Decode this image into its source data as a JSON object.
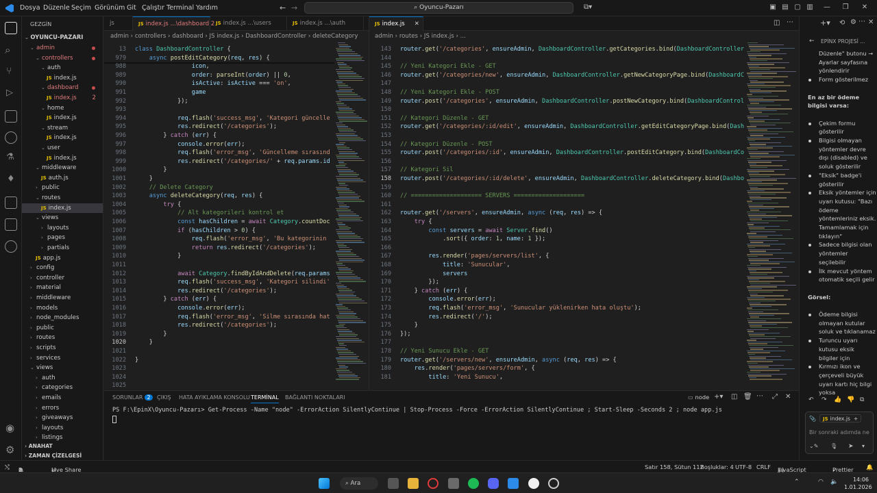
{
  "titlebar": {
    "menu": [
      "Dosya",
      "Düzenle",
      "Seçim",
      "Görünüm",
      "Git",
      "Çalıştır",
      "Terminal",
      "Yardım"
    ],
    "search": "Oyuncu-Pazarı"
  },
  "sidebar": {
    "header": "GEZGİN",
    "root": "OYUNCU-PAZARI",
    "items": [
      {
        "label": "admin",
        "depth": 1,
        "folder": true,
        "open": true,
        "dot": true
      },
      {
        "label": "controllers",
        "depth": 2,
        "folder": true,
        "open": true,
        "dot": true
      },
      {
        "label": "auth",
        "depth": 3,
        "folder": true,
        "open": true
      },
      {
        "label": "index.js",
        "depth": 4,
        "js": true
      },
      {
        "label": "dashboard",
        "depth": 3,
        "folder": true,
        "open": true,
        "dot": true
      },
      {
        "label": "index.js",
        "depth": 4,
        "js": true,
        "badge": "2"
      },
      {
        "label": "home",
        "depth": 3,
        "folder": true,
        "open": true
      },
      {
        "label": "index.js",
        "depth": 4,
        "js": true
      },
      {
        "label": "stream",
        "depth": 3,
        "folder": true,
        "open": true
      },
      {
        "label": "index.js",
        "depth": 4,
        "js": true
      },
      {
        "label": "user",
        "depth": 3,
        "folder": true,
        "open": true
      },
      {
        "label": "index.js",
        "depth": 4,
        "js": true
      },
      {
        "label": "middleware",
        "depth": 2,
        "folder": true,
        "open": true
      },
      {
        "label": "auth.js",
        "depth": 3,
        "js": true
      },
      {
        "label": "public",
        "depth": 2,
        "folder": true
      },
      {
        "label": "routes",
        "depth": 2,
        "folder": true,
        "open": true
      },
      {
        "label": "index.js",
        "depth": 3,
        "js": true,
        "selected": true
      },
      {
        "label": "views",
        "depth": 2,
        "folder": true,
        "open": true
      },
      {
        "label": "layouts",
        "depth": 3,
        "folder": true
      },
      {
        "label": "pages",
        "depth": 3,
        "folder": true
      },
      {
        "label": "partials",
        "depth": 3,
        "folder": true
      },
      {
        "label": "app.js",
        "depth": 2,
        "js": true
      },
      {
        "label": "config",
        "depth": 1,
        "folder": true
      },
      {
        "label": "controller",
        "depth": 1,
        "folder": true
      },
      {
        "label": "material",
        "depth": 1,
        "folder": true
      },
      {
        "label": "middleware",
        "depth": 1,
        "folder": true
      },
      {
        "label": "models",
        "depth": 1,
        "folder": true
      },
      {
        "label": "node_modules",
        "depth": 1,
        "folder": true
      },
      {
        "label": "public",
        "depth": 1,
        "folder": true
      },
      {
        "label": "routes",
        "depth": 1,
        "folder": true
      },
      {
        "label": "scripts",
        "depth": 1,
        "folder": true
      },
      {
        "label": "services",
        "depth": 1,
        "folder": true
      },
      {
        "label": "views",
        "depth": 1,
        "folder": true,
        "open": true
      },
      {
        "label": "auth",
        "depth": 2,
        "folder": true
      },
      {
        "label": "categories",
        "depth": 2,
        "folder": true
      },
      {
        "label": "emails",
        "depth": 2,
        "folder": true
      },
      {
        "label": "errors",
        "depth": 2,
        "folder": true
      },
      {
        "label": "giveaways",
        "depth": 2,
        "folder": true
      },
      {
        "label": "layouts",
        "depth": 2,
        "folder": true
      },
      {
        "label": "listings",
        "depth": 2,
        "folder": true
      }
    ],
    "outline": "ANAHAT",
    "timeline": "ZAMAN ÇİZELGESİ"
  },
  "left_editor": {
    "tabs": [
      {
        "label": "js",
        "active": false
      },
      {
        "label": "index.js ...\\dashboard 2",
        "active": true
      },
      {
        "label": "index.js ...\\users",
        "active": false
      },
      {
        "label": "index.js ...\\auth",
        "active": false
      }
    ],
    "breadcrumb": "admin › controllers › dashboard › JS index.js › DashboardController › deleteCategory",
    "sticky": [
      {
        "n": "13",
        "html": "<span class='kb'>class</span> <span class='t'>DashboardController</span> {"
      },
      {
        "n": "979",
        "html": "    <span class='kb'>async</span> <span class='f'>postEditCategory</span>(<span class='v'>req</span>, <span class='v'>res</span>) {"
      }
    ],
    "lines": [
      {
        "n": "988",
        "html": "                <span class='v'>icon</span>,"
      },
      {
        "n": "989",
        "html": "                <span class='v'>order</span>: <span class='f'>parseInt</span>(<span class='v'>order</span>) || <span class='n'>0</span>,"
      },
      {
        "n": "990",
        "html": "                <span class='v'>isActive</span>: <span class='v'>isActive</span> === <span class='s'>'on'</span>,"
      },
      {
        "n": "991",
        "html": "                <span class='v'>game</span>"
      },
      {
        "n": "992",
        "html": "            });"
      },
      {
        "n": "993",
        "html": ""
      },
      {
        "n": "994",
        "html": "            <span class='v'>req</span>.<span class='f'>flash</span>(<span class='s'>'success_msg'</span>, <span class='s'>'Kategori güncelle</span>"
      },
      {
        "n": "995",
        "html": "            <span class='v'>res</span>.<span class='f'>redirect</span>(<span class='s'>'/categories'</span>);"
      },
      {
        "n": "996",
        "html": "        } <span class='k'>catch</span> (<span class='v'>err</span>) {"
      },
      {
        "n": "997",
        "html": "            <span class='v'>console</span>.<span class='f'>error</span>(<span class='v'>err</span>);"
      },
      {
        "n": "998",
        "html": "            <span class='v'>req</span>.<span class='f'>flash</span>(<span class='s'>'error_msg'</span>, <span class='s'>'Güncelleme sırasınd</span>"
      },
      {
        "n": "999",
        "html": "            <span class='v'>res</span>.<span class='f'>redirect</span>(<span class='s'>'/categories/'</span> + <span class='v'>req</span>.<span class='v'>params</span>.<span class='v'>id</span>"
      },
      {
        "n": "1000",
        "html": "        }"
      },
      {
        "n": "1001",
        "html": "    }"
      },
      {
        "n": "1002",
        "html": "    <span class='c'>// Delete Category</span>"
      },
      {
        "n": "1003",
        "html": "    <span class='kb'>async</span> <span class='f'>deleteCategory</span>(<span class='v'>req</span>, <span class='v'>res</span>) {"
      },
      {
        "n": "1004",
        "html": "        <span class='k'>try</span> {"
      },
      {
        "n": "1005",
        "html": "            <span class='c'>// Alt kategorileri kontrol et</span>"
      },
      {
        "n": "1006",
        "html": "            <span class='kb'>const</span> <span class='v'>hasChildren</span> = <span class='k'>await</span> <span class='t'>Category</span>.<span class='f'>countDoc</span>"
      },
      {
        "n": "1007",
        "html": "            <span class='k'>if</span> (<span class='v'>hasChildren</span> > <span class='n'>0</span>) {"
      },
      {
        "n": "1008",
        "html": "                <span class='v'>req</span>.<span class='f'>flash</span>(<span class='s'>'error_msg'</span>, <span class='s'>'Bu kategorinin</span>"
      },
      {
        "n": "1009",
        "html": "                <span class='k'>return</span> <span class='v'>res</span>.<span class='f'>redirect</span>(<span class='s'>'/categories'</span>);"
      },
      {
        "n": "1010",
        "html": "            }"
      },
      {
        "n": "1011",
        "html": ""
      },
      {
        "n": "1012",
        "html": "            <span class='k'>await</span> <span class='t'>Category</span>.<span class='f'>findByIdAndDelete</span>(<span class='v'>req</span>.<span class='v'>params</span>"
      },
      {
        "n": "1013",
        "html": "            <span class='v'>req</span>.<span class='f'>flash</span>(<span class='s'>'success_msg'</span>, <span class='s'>'Kategori silindi'</span>"
      },
      {
        "n": "1014",
        "html": "            <span class='v'>res</span>.<span class='f'>redirect</span>(<span class='s'>'/categories'</span>);"
      },
      {
        "n": "1015",
        "html": "        } <span class='k'>catch</span> (<span class='v'>err</span>) {"
      },
      {
        "n": "1016",
        "html": "            <span class='v'>console</span>.<span class='f'>error</span>(<span class='v'>err</span>);"
      },
      {
        "n": "1017",
        "html": "            <span class='v'>req</span>.<span class='f'>flash</span>(<span class='s'>'error_msg'</span>, <span class='s'>'Silme sırasında hat</span>"
      },
      {
        "n": "1018",
        "html": "            <span class='v'>res</span>.<span class='f'>redirect</span>(<span class='s'>'/categories'</span>);"
      },
      {
        "n": "1019",
        "html": "        }"
      },
      {
        "n": "1020",
        "html": "    }"
      },
      {
        "n": "1021",
        "html": ""
      },
      {
        "n": "1022",
        "html": "}"
      },
      {
        "n": "1023",
        "html": ""
      },
      {
        "n": "1024",
        "html": ""
      },
      {
        "n": "1025",
        "html": ""
      }
    ]
  },
  "right_editor": {
    "tab": "index.js",
    "breadcrumb": "admin › routes › JS index.js › ...",
    "lines": [
      {
        "n": "143",
        "html": "<span class='v'>router</span>.<span class='f'>get</span>(<span class='s'>'/categories'</span>, <span class='v'>ensureAdmin</span>, <span class='t'>DashboardController</span>.<span class='f'>getCategories</span>.<span class='f'>bind</span>(<span class='t'>DashboardController</span>"
      },
      {
        "n": "144",
        "html": ""
      },
      {
        "n": "145",
        "html": "<span class='c'>// Yeni Kategori Ekle - GET</span>"
      },
      {
        "n": "146",
        "html": "<span class='v'>router</span>.<span class='f'>get</span>(<span class='s'>'/categories/new'</span>, <span class='v'>ensureAdmin</span>, <span class='t'>DashboardController</span>.<span class='f'>getNewCategoryPage</span>.<span class='f'>bind</span>(<span class='t'>DashboardCo</span>"
      },
      {
        "n": "147",
        "html": ""
      },
      {
        "n": "148",
        "html": "<span class='c'>// Yeni Kategori Ekle - POST</span>"
      },
      {
        "n": "149",
        "html": "<span class='v'>router</span>.<span class='f'>post</span>(<span class='s'>'/categories'</span>, <span class='v'>ensureAdmin</span>, <span class='t'>DashboardController</span>.<span class='f'>postNewCategory</span>.<span class='f'>bind</span>(<span class='t'>DashboardControll</span>"
      },
      {
        "n": "150",
        "html": ""
      },
      {
        "n": "151",
        "html": "<span class='c'>// Kategori Düzenle - GET</span>"
      },
      {
        "n": "152",
        "html": "<span class='v'>router</span>.<span class='f'>get</span>(<span class='s'>'/categories/:id/edit'</span>, <span class='v'>ensureAdmin</span>, <span class='t'>DashboardController</span>.<span class='f'>getEditCategoryPage</span>.<span class='f'>bind</span>(<span class='t'>Dash</span>"
      },
      {
        "n": "153",
        "html": ""
      },
      {
        "n": "154",
        "html": "<span class='c'>// Kategori Düzenle - POST</span>"
      },
      {
        "n": "155",
        "html": "<span class='v'>router</span>.<span class='f'>post</span>(<span class='s'>'/categories/:id'</span>, <span class='v'>ensureAdmin</span>, <span class='t'>DashboardController</span>.<span class='f'>postEditCategory</span>.<span class='f'>bind</span>(<span class='t'>DashboardCo</span>"
      },
      {
        "n": "156",
        "html": ""
      },
      {
        "n": "157",
        "html": "<span class='c'>// Kategori Sil</span>"
      },
      {
        "n": "158",
        "html": "<span class='v'>router</span>.<span class='f'>post</span>(<span class='s'>'/categories/:id/delete'</span>, <span class='v'>ensureAdmin</span>, <span class='t'>DashboardController</span>.<span class='f'>deleteCategory</span>.<span class='f'>bind</span>(<span class='t'>Dashbo</span>"
      },
      {
        "n": "159",
        "html": ""
      },
      {
        "n": "160",
        "html": "<span class='c'>// ==================== SERVERS ====================</span>"
      },
      {
        "n": "161",
        "html": ""
      },
      {
        "n": "162",
        "html": "<span class='v'>router</span>.<span class='f'>get</span>(<span class='s'>'/servers'</span>, <span class='v'>ensureAdmin</span>, <span class='kb'>async</span> (<span class='v'>req</span>, <span class='v'>res</span>) => {"
      },
      {
        "n": "163",
        "html": "    <span class='k'>try</span> {"
      },
      {
        "n": "164",
        "html": "        <span class='kb'>const</span> <span class='v'>servers</span> = <span class='k'>await</span> <span class='t'>Server</span>.<span class='f'>find</span>()"
      },
      {
        "n": "165",
        "html": "            .<span class='f'>sort</span>({ <span class='v'>order</span>: <span class='n'>1</span>, <span class='v'>name</span>: <span class='n'>1</span> });"
      },
      {
        "n": "166",
        "html": ""
      },
      {
        "n": "167",
        "html": "        <span class='v'>res</span>.<span class='f'>render</span>(<span class='s'>'pages/servers/list'</span>, {"
      },
      {
        "n": "168",
        "html": "            <span class='v'>title</span>: <span class='s'>'Sunucular'</span>,"
      },
      {
        "n": "169",
        "html": "            <span class='v'>servers</span>"
      },
      {
        "n": "170",
        "html": "        });"
      },
      {
        "n": "171",
        "html": "    } <span class='k'>catch</span> (<span class='v'>err</span>) {"
      },
      {
        "n": "172",
        "html": "        <span class='v'>console</span>.<span class='f'>error</span>(<span class='v'>err</span>);"
      },
      {
        "n": "173",
        "html": "        <span class='v'>req</span>.<span class='f'>flash</span>(<span class='s'>'error_msg'</span>, <span class='s'>'Sunucular yüklenirken hata oluştu'</span>);"
      },
      {
        "n": "174",
        "html": "        <span class='v'>res</span>.<span class='f'>redirect</span>(<span class='s'>'/'</span>);"
      },
      {
        "n": "175",
        "html": "    }"
      },
      {
        "n": "176",
        "html": "});"
      },
      {
        "n": "177",
        "html": ""
      },
      {
        "n": "178",
        "html": "<span class='c'>// Yeni Sunucu Ekle - GET</span>"
      },
      {
        "n": "179",
        "html": "<span class='v'>router</span>.<span class='f'>get</span>(<span class='s'>'/servers/new'</span>, <span class='v'>ensureAdmin</span>, <span class='kb'>async</span> (<span class='v'>req</span>, <span class='v'>res</span>) => {"
      },
      {
        "n": "180",
        "html": "    <span class='v'>res</span>.<span class='f'>render</span>(<span class='s'>'pages/servers/form'</span>, {"
      },
      {
        "n": "181",
        "html": "        <span class='v'>title</span>: <span class='s'>'Yeni Sunucu'</span>,"
      }
    ]
  },
  "panel": {
    "tabs": [
      "SORUNLAR",
      "ÇIKIŞ",
      "HATA AYIKLAMA KONSOLU",
      "TERMİNAL",
      "BAĞLANTI NOKTALARI"
    ],
    "problems_count": "2",
    "active_tab": "TERMİNAL",
    "terminal_name": "node",
    "terminal_line": "PS F:\\EpinX\\Oyuncu-Pazarı> Get-Process -Name \"node\" -ErrorAction SilentlyContinue | Stop-Process -Force -ErrorAction SilentlyContinue ; Start-Sleep -Seconds 2 ; node app.js"
  },
  "chat": {
    "header": "EPİNX PROJESİ ...",
    "lines": [
      {
        "t": "Düzenle\" butonu →",
        "b": false
      },
      {
        "t": "Ayarlar sayfasına",
        "b": false
      },
      {
        "t": "yönlendirir",
        "b": false
      },
      {
        "t": "Form gösterilmez",
        "b": true
      },
      {
        "t": "",
        "b": false
      },
      {
        "t": "En az bir ödeme",
        "b": false,
        "h": true
      },
      {
        "t": "bilgisi varsa:",
        "b": false,
        "h": true
      },
      {
        "t": "",
        "b": false
      },
      {
        "t": "Çekim formu",
        "b": true
      },
      {
        "t": "gösterilir",
        "b": false
      },
      {
        "t": "Bilgisi olmayan",
        "b": true
      },
      {
        "t": "yöntemler devre",
        "b": false
      },
      {
        "t": "dışı (disabled) ve",
        "b": false
      },
      {
        "t": "soluk gösterilir",
        "b": false
      },
      {
        "t": "\"Eksik\" badge'i",
        "b": true
      },
      {
        "t": "gösterilir",
        "b": false
      },
      {
        "t": "Eksik yöntemler için",
        "b": true
      },
      {
        "t": "uyarı kutusu: \"Bazı",
        "b": false
      },
      {
        "t": "ödeme",
        "b": false
      },
      {
        "t": "yöntemleriniz eksik.",
        "b": false
      },
      {
        "t": "Tamamlamak için",
        "b": false
      },
      {
        "t": "tıklayın\"",
        "b": false
      },
      {
        "t": "Sadece bilgisi olan",
        "b": true
      },
      {
        "t": "yöntemler",
        "b": false
      },
      {
        "t": "seçilebilir",
        "b": false
      },
      {
        "t": "İlk mevcut yöntem",
        "b": true
      },
      {
        "t": "otomatik seçili gelir",
        "b": false
      },
      {
        "t": "",
        "b": false
      },
      {
        "t": "Görsel:",
        "b": false,
        "h": true
      },
      {
        "t": "",
        "b": false
      },
      {
        "t": "Ödeme bilgisi",
        "b": true
      },
      {
        "t": "olmayan kutular",
        "b": false
      },
      {
        "t": "soluk ve tıklanamaz",
        "b": false
      },
      {
        "t": "Turuncu uyarı",
        "b": true
      },
      {
        "t": "kutusu eksik",
        "b": false
      },
      {
        "t": "bilgiler için",
        "b": false
      },
      {
        "t": "Kırmızı ikon ve",
        "b": true
      },
      {
        "t": "çerçeveli büyük",
        "b": false
      },
      {
        "t": "uyarı kartı hiç bilgi",
        "b": false
      },
      {
        "t": "yoksa",
        "b": false
      }
    ],
    "context_file": "index.js",
    "input_placeholder": "Bir sonraki adımda ne"
  },
  "statusbar": {
    "errors": "2",
    "warnings": "0",
    "live_share": "Live Share",
    "position": "Satır 158, Sütun 112",
    "spaces": "Boşluklar: 4",
    "encoding": "UTF-8",
    "eol": "CRLF",
    "language": "JavaScript",
    "prettier": "Prettier"
  },
  "taskbar": {
    "search": "Ara",
    "time": "14:06",
    "date": "1.01.2026"
  }
}
